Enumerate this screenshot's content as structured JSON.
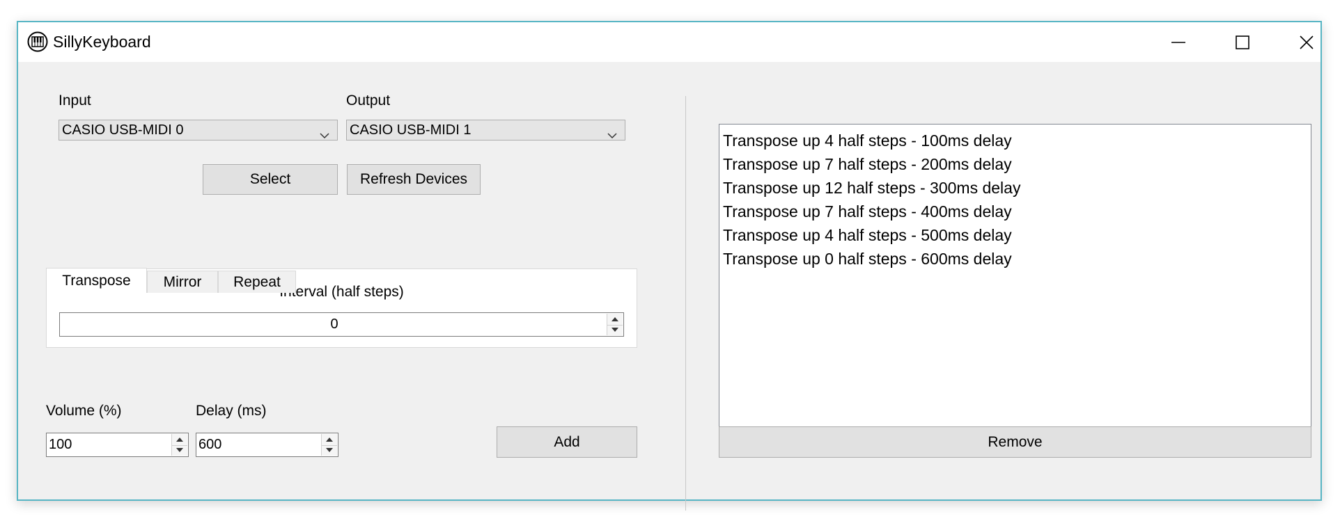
{
  "window": {
    "title": "SillyKeyboard"
  },
  "devices": {
    "input_label": "Input",
    "input_value": "CASIO USB-MIDI 0",
    "output_label": "Output",
    "output_value": "CASIO USB-MIDI 1",
    "select_label": "Select",
    "refresh_label": "Refresh Devices"
  },
  "tabs": [
    {
      "label": "Transpose",
      "active": true
    },
    {
      "label": "Mirror",
      "active": false
    },
    {
      "label": "Repeat",
      "active": false
    }
  ],
  "transpose": {
    "interval_label": "Interval (half steps)",
    "interval_value": "0"
  },
  "controls": {
    "volume_label": "Volume (%)",
    "volume_value": "100",
    "delay_label": "Delay (ms)",
    "delay_value": "600",
    "add_label": "Add"
  },
  "effects": {
    "items": [
      "Transpose up 4 half steps - 100ms delay",
      "Transpose up 7 half steps - 200ms delay",
      "Transpose up 12 half steps - 300ms delay",
      "Transpose up 7 half steps - 400ms delay",
      "Transpose up 4 half steps - 500ms delay",
      "Transpose up 0 half steps - 600ms delay"
    ],
    "remove_label": "Remove"
  },
  "icons": {
    "app": "piano-keyboard-icon",
    "minimize": "minimize-icon",
    "maximize": "maximize-icon",
    "close": "close-icon",
    "dropdown": "chevron-down-icon",
    "spin_up": "spin-up-icon",
    "spin_down": "spin-down-icon"
  },
  "colors": {
    "window_border": "#57b5c4",
    "window_background": "#f0f0f0",
    "titlebar": "#ffffff"
  }
}
